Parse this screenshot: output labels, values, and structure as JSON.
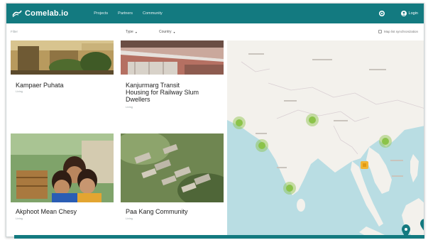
{
  "brand": {
    "name": "Comelab.io"
  },
  "nav": {
    "items": [
      "Projects",
      "Partners",
      "Community"
    ]
  },
  "user": {
    "label": "Login"
  },
  "filters": {
    "label": "Filter",
    "type_label": "Type",
    "country_label": "Country",
    "map_sync_label": "Map list synchronization"
  },
  "projects": [
    {
      "title_lines": [
        "Kampaer Puhata"
      ],
      "subtitle": "Living"
    },
    {
      "title_lines": [
        "Kanjurmarg Transit",
        "Housing for Railway Slum",
        "Dwellers"
      ],
      "subtitle": "Living"
    },
    {
      "title_lines": [
        "Akphoot Mean Chesy"
      ],
      "subtitle": "Living"
    },
    {
      "title_lines": [
        "Paa Kang Community"
      ],
      "subtitle": "Living"
    }
  ],
  "map": {
    "markers": [
      {
        "kind": "cluster",
        "color": "#8bc34a"
      },
      {
        "kind": "cluster",
        "color": "#8bc34a"
      },
      {
        "kind": "cluster",
        "color": "#8bc34a"
      },
      {
        "kind": "cluster",
        "color": "#8bc34a"
      },
      {
        "kind": "cluster",
        "color": "#8bc34a"
      },
      {
        "kind": "selected",
        "color": "#f2b431"
      },
      {
        "kind": "pin",
        "color": "#137a80"
      },
      {
        "kind": "pin",
        "color": "#137a80"
      }
    ]
  },
  "colors": {
    "primary": "#137a80",
    "map_water": "#b9dde3",
    "map_land": "#f3f1ec"
  }
}
